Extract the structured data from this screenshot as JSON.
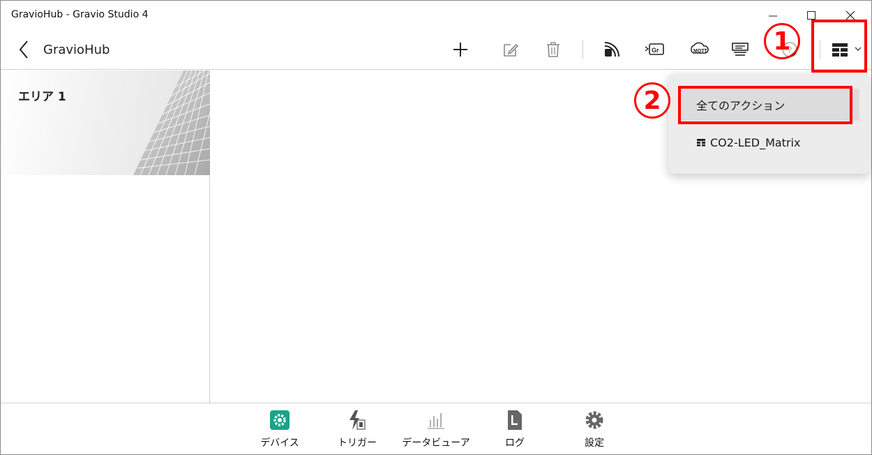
{
  "window": {
    "title": "GravioHub - Gravio Studio 4"
  },
  "toolbar": {
    "hub_name": "GravioHub",
    "buttons": [
      "add",
      "edit",
      "delete",
      "camera-device",
      "gr-device",
      "mqtt",
      "layers",
      "help",
      "action-filter"
    ]
  },
  "area": {
    "label": "エリア 1"
  },
  "dropdown": {
    "items": [
      "全てのアクション",
      "CO2-LED_Matrix"
    ],
    "selected": "全てのアクション"
  },
  "annotations": {
    "one": "1",
    "two": "2",
    "color": "#ff0000"
  },
  "bottom_nav": {
    "items": [
      "デバイス",
      "トリガー",
      "データビューア",
      "ログ",
      "設定"
    ],
    "active_color": "#1aa38a"
  }
}
